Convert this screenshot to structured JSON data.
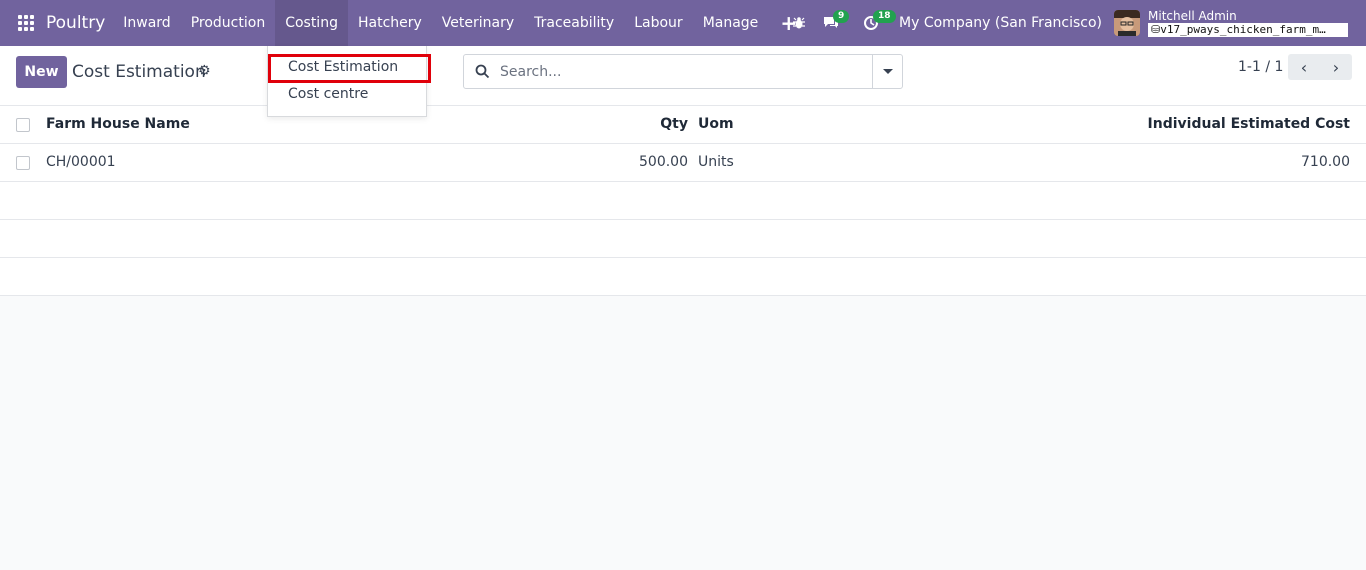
{
  "navbar": {
    "brand": "Poultry",
    "menu": [
      "Inward",
      "Production",
      "Costing",
      "Hatchery",
      "Veterinary",
      "Traceability",
      "Labour",
      "Manage"
    ],
    "active_menu": "Costing",
    "messages_count": "9",
    "activities_count": "18",
    "company": "My Company (San Francisco)",
    "user_name": "Mitchell Admin",
    "db_name": "v17_pways_chicken_farm_m…",
    "accent": "#71639e",
    "badge_color": "#22a24f"
  },
  "control": {
    "new_label": "New",
    "title": "Cost Estimation",
    "search_placeholder": "Search...",
    "pager": "1-1 / 1"
  },
  "dropdown": {
    "items": [
      "Cost Estimation",
      "Cost centre"
    ],
    "highlighted": "Cost Estimation",
    "highlight_color": "#e0000a"
  },
  "table": {
    "headers": {
      "name": "Farm House Name",
      "qty": "Qty",
      "uom": "Uom",
      "cost": "Individual Estimated Cost"
    },
    "rows": [
      {
        "name": "CH/00001",
        "qty": "500.00",
        "uom": "Units",
        "cost": "710.00"
      }
    ]
  }
}
